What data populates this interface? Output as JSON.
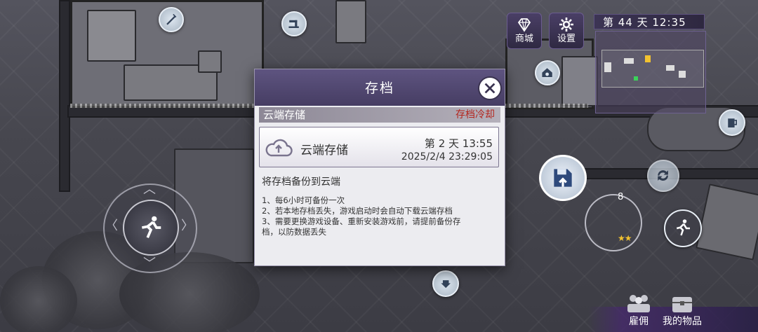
{
  "hud": {
    "shop_label": "商城",
    "settings_label": "设置",
    "day_time": "第 44 天  12:35",
    "ammo_count": "8",
    "stars": "★★",
    "hire_label": "雇佣",
    "items_label": "我的物品"
  },
  "modal": {
    "title": "存档",
    "section_label": "云端存储",
    "cooldown_label": "存档冷却",
    "slot": {
      "name": "云端存储",
      "day_time": "第 2 天  13:55",
      "datetime": "2025/2/4 23:29:05"
    },
    "desc_title": "将存档备份到云端",
    "desc_lines": [
      "1、每6小时可备份一次",
      "2、若本地存档丢失，游戏启动时会自动下载云端存档",
      "3、需要更换游戏设备、重新安装游戏前，请提前备份存",
      "档，以防数据丢失"
    ]
  },
  "colors": {
    "header_purple": "#463d63",
    "cooldown_red": "#b4261e",
    "star_gold": "#f2c230"
  }
}
